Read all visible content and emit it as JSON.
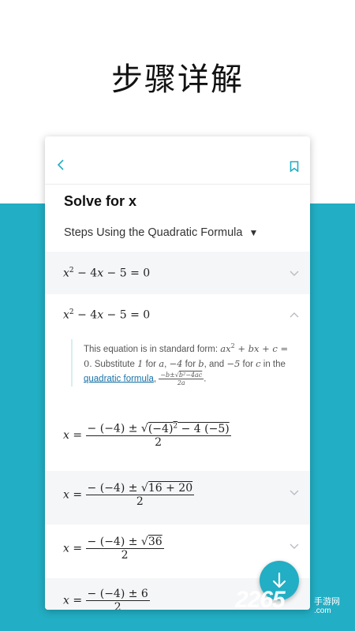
{
  "promo": {
    "title": "步骤详解"
  },
  "card": {
    "heading": "Solve for x",
    "method_label": "Steps Using the Quadratic Formula",
    "method_caret": "▼",
    "steps": [
      {
        "equation": "x² − 4x − 5 = 0",
        "expanded": false
      },
      {
        "equation": "x² − 4x − 5 = 0",
        "expanded": true
      },
      {
        "equation": "x = (−(−4) ± √((−4)² − 4(−5))) / 2",
        "expanded": false
      },
      {
        "equation": "x = (−(−4) ± √(16 + 20)) / 2",
        "expanded": false
      },
      {
        "equation": "x = (−(−4) ± √36) / 2",
        "expanded": false
      },
      {
        "equation": "x = (−(−4) ± 6) / 2",
        "expanded": false
      }
    ],
    "explanation": {
      "text_1": "This equation is in standard form: ",
      "std_form": "ax² + bx + c = 0",
      "text_2": ". Substitute 1 for a, −4 for b, and −5 for c in the ",
      "link": "quadratic formula",
      "formula": "(−b ± √(b² − 4ac)) / 2a"
    }
  },
  "watermark": {
    "brand": "2265",
    "sub": "手游网",
    "domain": ".com"
  },
  "colors": {
    "accent": "#22aec4",
    "math_blue": "#1e6fa0",
    "shaded_row": "#f5f6f8"
  },
  "icons": {
    "back": "chevron-left-icon",
    "bookmark": "bookmark-icon",
    "expand": "chevron-down-icon",
    "collapse": "chevron-up-icon",
    "fab": "arrow-down-icon"
  }
}
